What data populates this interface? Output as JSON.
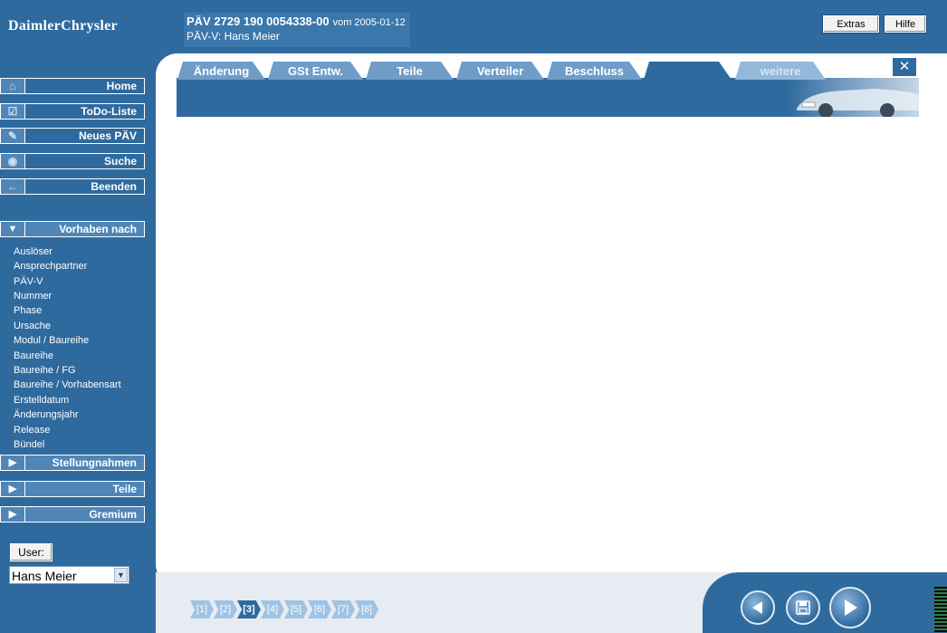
{
  "header": {
    "logo": "DaimlerChrysler",
    "title": "PÄV 2729 190 0054338-00",
    "date": "vom 2005-01-12",
    "subtitle": "PÄV-V: Hans Meier",
    "extras_label": "Extras",
    "hilfe_label": "Hilfe"
  },
  "nav": {
    "buttons": [
      {
        "label": "Home",
        "icon": "home-icon"
      },
      {
        "label": "ToDo-Liste",
        "icon": "checkbox-icon"
      },
      {
        "label": "Neues PÄV",
        "icon": "pencil-icon"
      },
      {
        "label": "Suche",
        "icon": "eye-icon"
      },
      {
        "label": "Beenden",
        "icon": "arrow-left-icon"
      }
    ],
    "section_label": "Vorhaben nach",
    "items": [
      "Auslöser",
      "Ansprechpartner",
      "PÄV-V",
      "Nummer",
      "Phase",
      "Ursache",
      "Modul / Baureihe",
      "Baureihe",
      "Baureihe / FG",
      "Baureihe / Vorhabensart",
      "Erstelldatum",
      "Änderungsjahr",
      "Release",
      "Bündel"
    ],
    "collapsed": [
      "Stellungnahmen",
      "Teile",
      "Gremium"
    ]
  },
  "user": {
    "button_label": "User:",
    "selected": "Hans Meier"
  },
  "tabs": [
    "Änderung",
    "GSt Entw.",
    "Teile",
    "Verteiler",
    "Beschluss",
    "",
    "weitere"
  ],
  "active_tab_index": 5,
  "steps": [
    "[1]",
    "[2]",
    "[3]",
    "[4]",
    "[5]",
    "[6]",
    "[7]",
    "[8]"
  ],
  "active_step_index": 2,
  "colors": {
    "primary": "#2f6a9e",
    "tab": "#6f9dc8",
    "step": "#9ec3e3"
  }
}
